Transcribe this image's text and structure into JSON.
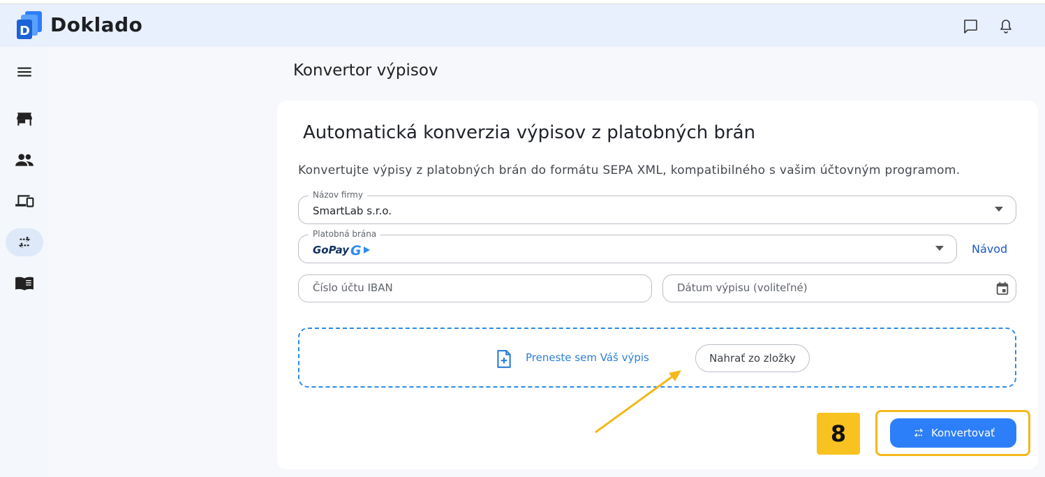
{
  "app": {
    "brand": "Doklado",
    "logo_letter": "D"
  },
  "topbar": {
    "icons": [
      "chat-icon",
      "bell-icon"
    ]
  },
  "sidebar": {
    "items": [
      {
        "icon": "menu-icon",
        "active": false
      },
      {
        "icon": "store-icon",
        "active": false
      },
      {
        "icon": "people-icon",
        "active": false
      },
      {
        "icon": "devices-icon",
        "active": false
      },
      {
        "icon": "convert-arrows-icon",
        "active": true
      },
      {
        "icon": "book-icon",
        "active": false
      }
    ]
  },
  "page": {
    "title": "Konvertor výpisov"
  },
  "card": {
    "title": "Automatická konverzia výpisov z platobných brán",
    "description": "Konvertujte výpisy z platobných brán do formátu SEPA XML, kompatibilného s vašim účtovným programom."
  },
  "form": {
    "company": {
      "label": "Názov firmy",
      "value": "SmartLab s.r.o."
    },
    "gateway": {
      "label": "Platobná brána",
      "value": "GoPay",
      "logo_letter": "G"
    },
    "guide_link": "Návod",
    "iban": {
      "placeholder": "Číslo účtu IBAN"
    },
    "date": {
      "placeholder": "Dátum výpisu (voliteľné)"
    }
  },
  "dropzone": {
    "text": "Preneste sem Váš výpis",
    "upload_button": "Nahrať zo zložky"
  },
  "step_badge": "8",
  "convert_button": "Konvertovať",
  "colors": {
    "accent": "#2d7ff9",
    "highlight": "#f3b81a",
    "badge": "#f8c320",
    "topbar": "#e8f0fe"
  }
}
